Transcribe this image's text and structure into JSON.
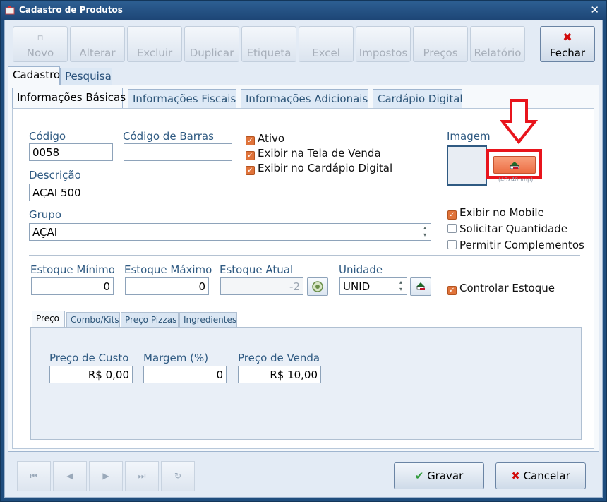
{
  "window": {
    "title": "Cadastro de Produtos"
  },
  "toolbar": {
    "buttons": [
      {
        "label": "Novo"
      },
      {
        "label": "Alterar"
      },
      {
        "label": "Excluir"
      },
      {
        "label": "Duplicar"
      },
      {
        "label": "Etiqueta"
      },
      {
        "label": "Excel"
      },
      {
        "label": "Impostos"
      },
      {
        "label": "Preços"
      },
      {
        "label": "Relatório"
      },
      {
        "label": "Fechar"
      }
    ]
  },
  "main_tabs": [
    {
      "label": "Cadastro"
    },
    {
      "label": "Pesquisa"
    }
  ],
  "sub_tabs": [
    {
      "label": "Informações Básicas"
    },
    {
      "label": "Informações Fiscais"
    },
    {
      "label": "Informações Adicionais"
    },
    {
      "label": "Cardápio Digital"
    }
  ],
  "form": {
    "codigo": {
      "label": "Código",
      "value": "0058"
    },
    "codigo_barras": {
      "label": "Código de Barras",
      "value": ""
    },
    "descricao": {
      "label": "Descrição",
      "value": "AÇAI 500"
    },
    "grupo": {
      "label": "Grupo",
      "value": "AÇAI"
    },
    "checks_top": [
      {
        "label": "Ativo",
        "checked": true
      },
      {
        "label": "Exibir na Tela de Venda",
        "checked": true
      },
      {
        "label": "Exibir no Cardápio Digital",
        "checked": true
      }
    ],
    "imagem": {
      "label": "Imagem",
      "note": "(40x40bmp)"
    },
    "checks_right": [
      {
        "label": "Exibir no Mobile",
        "checked": true
      },
      {
        "label": "Solicitar Quantidade",
        "checked": false
      },
      {
        "label": "Permitir Complementos",
        "checked": false
      }
    ],
    "estoque_minimo": {
      "label": "Estoque Mínimo",
      "value": "0"
    },
    "estoque_maximo": {
      "label": "Estoque Máximo",
      "value": "0"
    },
    "estoque_atual": {
      "label": "Estoque Atual",
      "value": "-2"
    },
    "unidade": {
      "label": "Unidade",
      "value": "UNID"
    },
    "controlar_estoque": {
      "label": "Controlar Estoque",
      "checked": true
    }
  },
  "price_tabs": [
    {
      "label": "Preço"
    },
    {
      "label": "Combo/Kits"
    },
    {
      "label": "Preço Pizzas"
    },
    {
      "label": "Ingredientes"
    }
  ],
  "pricing": {
    "custo": {
      "label": "Preço de Custo",
      "value": "R$ 0,00"
    },
    "margem": {
      "label": "Margem (%)",
      "value": "0"
    },
    "venda": {
      "label": "Preço de Venda",
      "value": "R$ 10,00"
    }
  },
  "footer": {
    "save_label": "Gravar",
    "cancel_label": "Cancelar"
  },
  "colors": {
    "accent": "#e0733a",
    "highlight": "#e8141c",
    "title_bar": "#1f4d7d"
  }
}
